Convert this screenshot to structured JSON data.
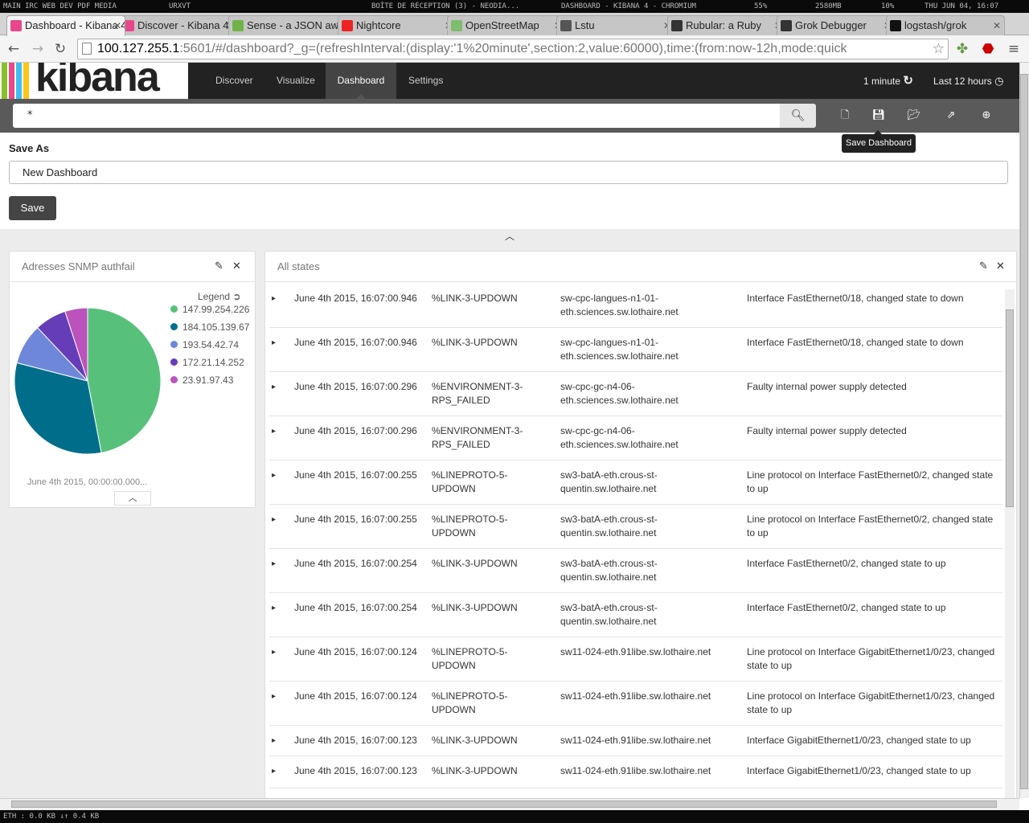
{
  "wm": {
    "workspaces": "MAIN IRC WEB DEV PDF MEDIA",
    "term": "URXVT",
    "mail": "BOÎTE DE RÉCEPTION (3) - NEODIA...",
    "window_title": "DASHBOARD - KIBANA 4 - CHROMIUM",
    "volume": "55%",
    "mem": "2580MB",
    "cpu": "10%",
    "clock": "THU JUN 04, 16:07"
  },
  "tabs": [
    {
      "title": "Dashboard - Kibana 4",
      "color": "#e8488b"
    },
    {
      "title": "Discover - Kibana 4",
      "color": "#e8488b"
    },
    {
      "title": "Sense - a JSON aware",
      "color": "#71b34a"
    },
    {
      "title": "Nightcore",
      "color": "#e22"
    },
    {
      "title": "OpenStreetMap",
      "color": "#7ebc6f"
    },
    {
      "title": "Lstu",
      "color": "#555"
    },
    {
      "title": "Rubular: a Ruby",
      "color": "#333"
    },
    {
      "title": "Grok Debugger",
      "color": "#333"
    },
    {
      "title": "logstash/grok",
      "color": "#111"
    }
  ],
  "url": {
    "host": "100.127.255.1",
    "rest": ":5601/#/dashboard?_g=(refreshInterval:(display:'1%20minute',section:2,value:60000),time:(from:now-12h,mode:quick"
  },
  "nav": {
    "logo": "kibana",
    "links": [
      "Discover",
      "Visualize",
      "Dashboard",
      "Settings"
    ],
    "refresh": "1 minute",
    "time": "Last 12 hours"
  },
  "search": {
    "query": "*"
  },
  "tooltip": "Save Dashboard",
  "save": {
    "label": "Save As",
    "value": "New Dashboard",
    "button": "Save"
  },
  "pie_panel": {
    "title": "Adresses SNMP authfail",
    "legend_title": "Legend",
    "footer": "June 4th 2015, 00:00:00.000..."
  },
  "chart_data": {
    "type": "pie",
    "title": "Adresses SNMP authfail",
    "categories": [
      "147.99.254.226",
      "184.105.139.67",
      "193.54.42.74",
      "172.21.14.252",
      "23.91.97.43"
    ],
    "values": [
      47,
      32,
      9,
      7,
      5
    ],
    "colors": [
      "#57c17b",
      "#006e8a",
      "#6f87d8",
      "#663db8",
      "#bc52bc"
    ],
    "legend": "top-right"
  },
  "table_panel": {
    "title": "All states"
  },
  "rows": [
    {
      "time": "June 4th 2015, 16:07:00.946",
      "type": "%LINK-3-UPDOWN",
      "host": "sw-cpc-langues-n1-01-eth.sciences.sw.lothaire.net",
      "msg": "Interface FastEthernet0/18, changed state to down"
    },
    {
      "time": "June 4th 2015, 16:07:00.946",
      "type": "%LINK-3-UPDOWN",
      "host": "sw-cpc-langues-n1-01-eth.sciences.sw.lothaire.net",
      "msg": "Interface FastEthernet0/18, changed state to down"
    },
    {
      "time": "June 4th 2015, 16:07:00.296",
      "type": "%ENVIRONMENT-3-RPS_FAILED",
      "host": "sw-cpc-gc-n4-06-eth.sciences.sw.lothaire.net",
      "msg": "Faulty internal power supply detected"
    },
    {
      "time": "June 4th 2015, 16:07:00.296",
      "type": "%ENVIRONMENT-3-RPS_FAILED",
      "host": "sw-cpc-gc-n4-06-eth.sciences.sw.lothaire.net",
      "msg": "Faulty internal power supply detected"
    },
    {
      "time": "June 4th 2015, 16:07:00.255",
      "type": "%LINEPROTO-5-UPDOWN",
      "host": "sw3-batA-eth.crous-st-quentin.sw.lothaire.net",
      "msg": "Line protocol on Interface FastEthernet0/2, changed state to up"
    },
    {
      "time": "June 4th 2015, 16:07:00.255",
      "type": "%LINEPROTO-5-UPDOWN",
      "host": "sw3-batA-eth.crous-st-quentin.sw.lothaire.net",
      "msg": "Line protocol on Interface FastEthernet0/2, changed state to up"
    },
    {
      "time": "June 4th 2015, 16:07:00.254",
      "type": "%LINK-3-UPDOWN",
      "host": "sw3-batA-eth.crous-st-quentin.sw.lothaire.net",
      "msg": "Interface FastEthernet0/2, changed state to up"
    },
    {
      "time": "June 4th 2015, 16:07:00.254",
      "type": "%LINK-3-UPDOWN",
      "host": "sw3-batA-eth.crous-st-quentin.sw.lothaire.net",
      "msg": "Interface FastEthernet0/2, changed state to up"
    },
    {
      "time": "June 4th 2015, 16:07:00.124",
      "type": "%LINEPROTO-5-UPDOWN",
      "host": "sw11-024-eth.91libe.sw.lothaire.net",
      "msg": "Line protocol on Interface GigabitEthernet1/0/23, changed state to up"
    },
    {
      "time": "June 4th 2015, 16:07:00.124",
      "type": "%LINEPROTO-5-UPDOWN",
      "host": "sw11-024-eth.91libe.sw.lothaire.net",
      "msg": "Line protocol on Interface GigabitEthernet1/0/23, changed state to up"
    },
    {
      "time": "June 4th 2015, 16:07:00.123",
      "type": "%LINK-3-UPDOWN",
      "host": "sw11-024-eth.91libe.sw.lothaire.net",
      "msg": "Interface GigabitEthernet1/0/23, changed state to up"
    },
    {
      "time": "June 4th 2015, 16:07:00.123",
      "type": "%LINK-3-UPDOWN",
      "host": "sw11-024-eth.91libe.sw.lothaire.net",
      "msg": "Interface GigabitEthernet1/0/23, changed state to up"
    }
  ],
  "status_bar": "ETH : 0.0 KB ↓↑ 0.4 KB"
}
